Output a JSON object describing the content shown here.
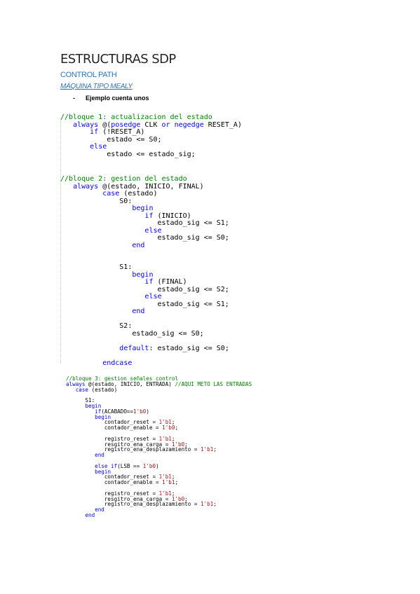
{
  "title": "ESTRUCTURAS SDP",
  "subtitle": "CONTROL PATH",
  "section": "MÁQUINA TIPO MEALY",
  "bullet": {
    "marker": "-",
    "text": "Ejemplo cuenta unos"
  },
  "code_blocks": [
    {
      "lines": [
        [
          {
            "t": "//bloque 1: actualizacion del estado",
            "k": "c"
          }
        ],
        [
          {
            "t": "   "
          },
          {
            "t": "always",
            "k": "k"
          },
          {
            "t": " @("
          },
          {
            "t": "posedge",
            "k": "k"
          },
          {
            "t": " CLK "
          },
          {
            "t": "or",
            "k": "k"
          },
          {
            "t": " "
          },
          {
            "t": "negedge",
            "k": "k"
          },
          {
            "t": " RESET_A)"
          }
        ],
        [
          {
            "t": "       "
          },
          {
            "t": "if",
            "k": "k"
          },
          {
            "t": " (!RESET_A)"
          }
        ],
        [
          {
            "t": "           estado <= S0;"
          }
        ],
        [
          {
            "t": "       "
          },
          {
            "t": "else",
            "k": "k"
          }
        ],
        [
          {
            "t": "           estado <= estado_sig;"
          }
        ]
      ]
    },
    {
      "lines": [
        [
          {
            "t": "//bloque 2: gestion del estado",
            "k": "c"
          }
        ],
        [
          {
            "t": "   "
          },
          {
            "t": "always",
            "k": "k"
          },
          {
            "t": " @(estado, INICIO, FINAL)"
          }
        ],
        [
          {
            "t": "          "
          },
          {
            "t": "case",
            "k": "k"
          },
          {
            "t": " (estado)"
          }
        ],
        [
          {
            "t": "              S0:"
          }
        ],
        [
          {
            "t": "                 "
          },
          {
            "t": "begin",
            "k": "k"
          }
        ],
        [
          {
            "t": "                    "
          },
          {
            "t": "if",
            "k": "k"
          },
          {
            "t": " (INICIO)"
          }
        ],
        [
          {
            "t": "                       estado_sig <= S1;"
          }
        ],
        [
          {
            "t": "                    "
          },
          {
            "t": "else",
            "k": "k"
          }
        ],
        [
          {
            "t": "                       estado_sig <= S0;"
          }
        ],
        [
          {
            "t": "                 "
          },
          {
            "t": "end",
            "k": "k"
          }
        ],
        [
          {
            "t": ""
          }
        ],
        [
          {
            "t": ""
          }
        ],
        [
          {
            "t": "              S1:"
          }
        ],
        [
          {
            "t": "                 "
          },
          {
            "t": "begin",
            "k": "k"
          }
        ],
        [
          {
            "t": "                    "
          },
          {
            "t": "if",
            "k": "k"
          },
          {
            "t": " (FINAL)"
          }
        ],
        [
          {
            "t": "                       estado_sig <= S2;"
          }
        ],
        [
          {
            "t": "                    "
          },
          {
            "t": "else",
            "k": "k"
          }
        ],
        [
          {
            "t": "                       estado_sig <= S1;"
          }
        ],
        [
          {
            "t": "                 "
          },
          {
            "t": "end",
            "k": "k"
          }
        ],
        [
          {
            "t": ""
          }
        ],
        [
          {
            "t": "              S2:"
          }
        ],
        [
          {
            "t": "                 estado_sig <= S0;"
          }
        ],
        [
          {
            "t": ""
          }
        ],
        [
          {
            "t": "              "
          },
          {
            "t": "default",
            "k": "k"
          },
          {
            "t": ": estado_sig <= S0;"
          }
        ],
        [
          {
            "t": ""
          }
        ],
        [
          {
            "t": "          "
          },
          {
            "t": "endcase",
            "k": "k"
          }
        ]
      ]
    },
    {
      "lines": [
        [
          {
            "t": "//bloque 3: gestion señales control",
            "k": "c"
          }
        ],
        [
          {
            "t": "always",
            "k": "k"
          },
          {
            "t": " @(estado, INICIO, ENTRADA) "
          },
          {
            "t": "//AQUI METO LAS ENTRADAS",
            "k": "c"
          }
        ],
        [
          {
            "t": "   "
          },
          {
            "t": "case",
            "k": "k"
          },
          {
            "t": " (estado)"
          }
        ],
        [
          {
            "t": ""
          }
        ],
        [
          {
            "t": "      S1:"
          }
        ],
        [
          {
            "t": "      "
          },
          {
            "t": "begin",
            "k": "k"
          }
        ],
        [
          {
            "t": "         "
          },
          {
            "t": "if",
            "k": "k"
          },
          {
            "t": "(ACABADO=="
          },
          {
            "t": "1'b0",
            "k": "n"
          },
          {
            "t": ")"
          }
        ],
        [
          {
            "t": "         "
          },
          {
            "t": "begin",
            "k": "k"
          }
        ],
        [
          {
            "t": "            contador_reset = "
          },
          {
            "t": "1'b1",
            "k": "n"
          },
          {
            "t": ";"
          }
        ],
        [
          {
            "t": "            contador_enable = "
          },
          {
            "t": "1'b0",
            "k": "n"
          },
          {
            "t": ";"
          }
        ],
        [
          {
            "t": ""
          }
        ],
        [
          {
            "t": "            registro_reset = "
          },
          {
            "t": "1'b1",
            "k": "n"
          },
          {
            "t": ";"
          }
        ],
        [
          {
            "t": "            resgitro_ena_carga = "
          },
          {
            "t": "1'b0",
            "k": "n"
          },
          {
            "t": ";"
          }
        ],
        [
          {
            "t": "            registro_ena_desplazamiento = "
          },
          {
            "t": "1'b1",
            "k": "n"
          },
          {
            "t": ";"
          }
        ],
        [
          {
            "t": "         "
          },
          {
            "t": "end",
            "k": "k"
          }
        ],
        [
          {
            "t": ""
          }
        ],
        [
          {
            "t": "         "
          },
          {
            "t": "else",
            "k": "k"
          },
          {
            "t": " "
          },
          {
            "t": "if",
            "k": "k"
          },
          {
            "t": "(LSB == "
          },
          {
            "t": "1'b0",
            "k": "n"
          },
          {
            "t": ")"
          }
        ],
        [
          {
            "t": "         "
          },
          {
            "t": "begin",
            "k": "k"
          }
        ],
        [
          {
            "t": "            contador_reset = "
          },
          {
            "t": "1'b1",
            "k": "n"
          },
          {
            "t": ";"
          }
        ],
        [
          {
            "t": "            contador_enable = "
          },
          {
            "t": "1'b1",
            "k": "n"
          },
          {
            "t": ";"
          }
        ],
        [
          {
            "t": ""
          }
        ],
        [
          {
            "t": "            registro_reset = "
          },
          {
            "t": "1'b1",
            "k": "n"
          },
          {
            "t": ";"
          }
        ],
        [
          {
            "t": "            resgitro_ena_carga = "
          },
          {
            "t": "1'b0",
            "k": "n"
          },
          {
            "t": ";"
          }
        ],
        [
          {
            "t": "            registro_ena_desplazamiento = "
          },
          {
            "t": "1'b1",
            "k": "n"
          },
          {
            "t": ";"
          }
        ],
        [
          {
            "t": "         "
          },
          {
            "t": "end",
            "k": "k"
          }
        ],
        [
          {
            "t": "      "
          },
          {
            "t": "end",
            "k": "k"
          }
        ]
      ]
    }
  ]
}
